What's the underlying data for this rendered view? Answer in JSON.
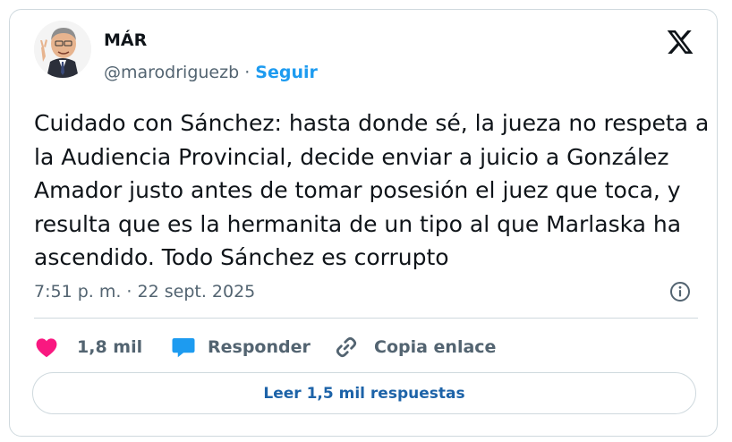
{
  "author": {
    "display_name": "MÁR",
    "handle": "@marodriguezb",
    "separator": "·",
    "follow_label": "Seguir"
  },
  "tweet": {
    "text": "Cuidado con Sánchez: hasta donde sé, la jueza no respeta a la Audiencia Provincial, decide enviar a juicio a González Amador justo antes de tomar posesión el juez que toca, y resulta que es la hermanita de un tipo al que Marlaska ha ascendido. Todo Sánchez es corrupto",
    "timestamp": "7:51 p. m. · 22 sept. 2025"
  },
  "actions": {
    "likes": "1,8 mil",
    "reply_label": "Responder",
    "copy_label": "Copia enlace"
  },
  "read_replies_label": "Leer 1,5 mil respuestas",
  "icons": {
    "platform": "x-logo-icon",
    "info": "info-icon",
    "like": "heart-icon",
    "reply": "speech-bubble-icon",
    "copy": "link-icon"
  },
  "colors": {
    "like": "#f91880",
    "reply": "#1d9bf0",
    "link_text": "#1d63a8",
    "secondary_text": "#536471"
  }
}
